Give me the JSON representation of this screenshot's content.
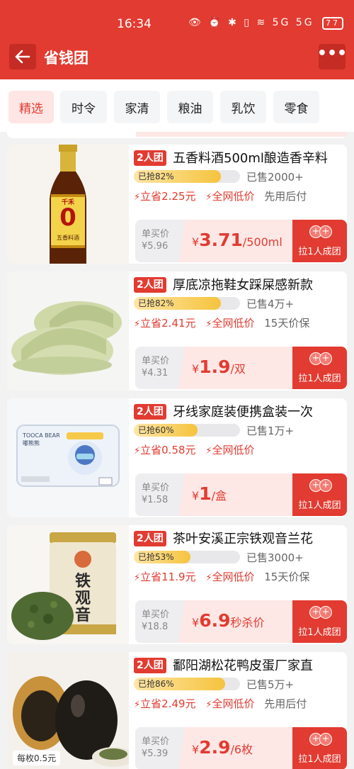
{
  "status_bar": {
    "time": "16:34",
    "icons_text": "👁 ⏰ ✱ ▯ ≋ 5G 5G",
    "battery": "77"
  },
  "header": {
    "title": "省钱团",
    "back_icon": "back-arrow-icon",
    "more_icon": "more-dots-icon"
  },
  "tabs": [
    "精选",
    "时令",
    "家清",
    "粮油",
    "乳饮",
    "零食"
  ],
  "active_tab": "精选",
  "labels": {
    "single_price": "单买价",
    "cta": "拉1人成团",
    "yen": "¥"
  },
  "colors": {
    "brand_red": "#e23b31",
    "progress_yellow": "#f5c33d"
  },
  "products": [
    {
      "badge": "2人团",
      "title": "五香料酒500ml酿造香辛料",
      "progress_text": "已抢82%",
      "progress": 0.82,
      "sold": "已售2000+",
      "benefits": [
        "立省2.25元",
        "全网低价",
        "先用后付"
      ],
      "single_price": "¥5.96",
      "price": "3.71",
      "unit": "/500ml",
      "image": "cooking-wine-bottle",
      "image_text": "千禾 0 五香料酒"
    },
    {
      "badge": "2人团",
      "title": "厚底凉拖鞋女踩屎感新款",
      "progress_text": "已抢82%",
      "progress": 0.82,
      "sold": "已售4万+",
      "benefits": [
        "立省2.41元",
        "全网低价",
        "15天价保"
      ],
      "single_price": "¥4.31",
      "price": "1.9",
      "unit": "/双",
      "image": "green-slippers"
    },
    {
      "badge": "2人团",
      "title": "牙线家庭装便携盒装一次",
      "progress_text": "已抢60%",
      "progress": 0.6,
      "sold": "已售1万+",
      "benefits": [
        "立省0.58元",
        "全网低价"
      ],
      "single_price": "¥1.58",
      "price": "1",
      "unit": "/盒",
      "image": "floss-box",
      "image_text": "TOOCA BEAR 嘟熊熊 50"
    },
    {
      "badge": "2人团",
      "title": "茶叶安溪正宗铁观音兰花",
      "progress_text": "已抢53%",
      "progress": 0.53,
      "sold": "已售3000+",
      "benefits": [
        "立省11.9元",
        "全网低价",
        "15天价保"
      ],
      "single_price": "¥18.8",
      "price": "6.9",
      "unit": "秒杀价",
      "image": "tea-can",
      "image_text": "铁观音"
    },
    {
      "badge": "2人团",
      "title": "鄱阳湖松花鸭皮蛋厂家直",
      "progress_text": "已抢86%",
      "progress": 0.86,
      "sold": "已售5万+",
      "benefits": [
        "立省2.49元",
        "全网低价",
        "先用后付"
      ],
      "single_price": "¥5.39",
      "price": "2.9",
      "unit": "/6枚",
      "image": "century-eggs",
      "image_text": "每枚0.5元"
    }
  ]
}
